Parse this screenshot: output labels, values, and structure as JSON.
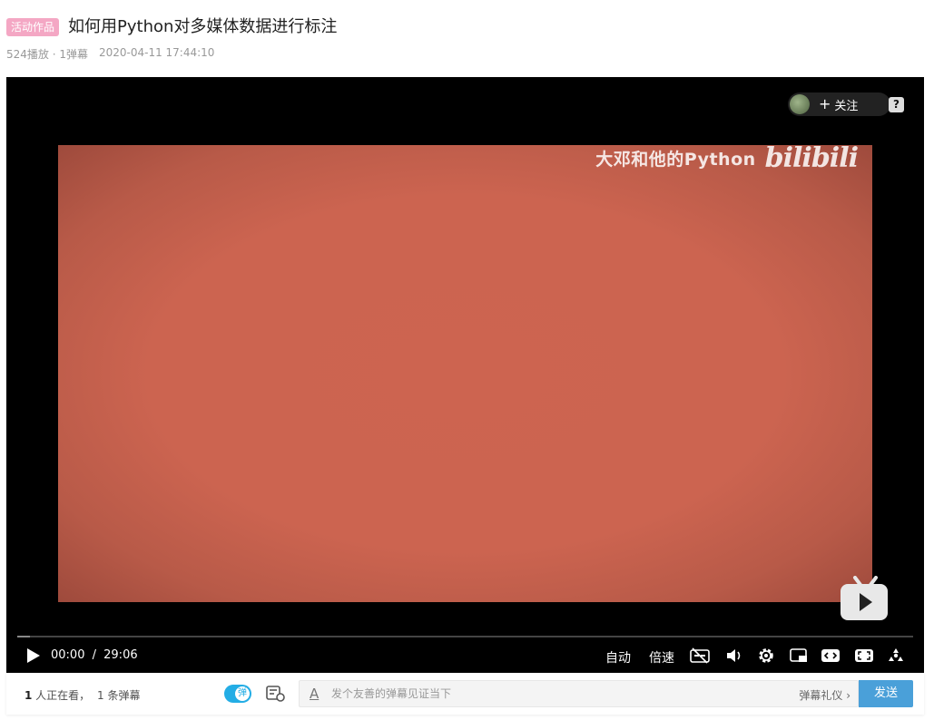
{
  "header": {
    "badge": "活动作品",
    "title": "如何用Python对多媒体数据进行标注",
    "play_count": "524播放 · 1弹幕",
    "date": "2020-04-11 17:44:10"
  },
  "player": {
    "watermark_text": "大邓和他的Python",
    "watermark_logo": "bilibili",
    "follow_label": "关注",
    "help_label": "?",
    "current_time": "00:00",
    "time_separator": "/",
    "duration": "29:06",
    "progress": 0.0,
    "auto_label": "自动",
    "speed_label": "倍速",
    "colors": {
      "video_bg": "#cc6450",
      "accent": "#23ade5"
    }
  },
  "bottom": {
    "viewers_count": "1",
    "viewers_text": " 人正在看，",
    "danmaku_count": "1",
    "danmaku_text": " 条弹幕",
    "toggle_label": "弹",
    "input_placeholder": "发个友善的弹幕见证当下",
    "etiquette_label": "弹幕礼仪 ›",
    "send_label": "发送"
  }
}
